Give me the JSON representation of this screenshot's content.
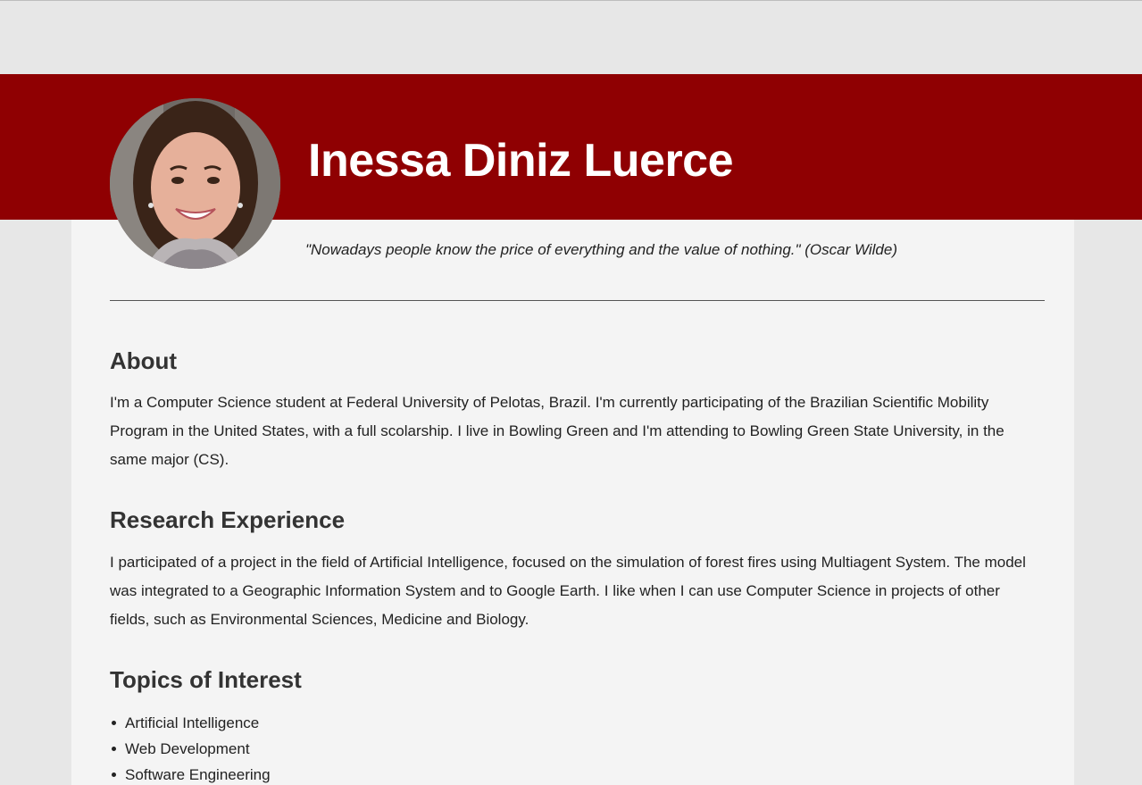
{
  "header": {
    "name": "Inessa Diniz Luerce",
    "quote": "\"Nowadays people know the price of everything and the value of nothing.\" (Oscar Wilde)",
    "colors": {
      "band": "#8f0002",
      "name_text": "#ffffff"
    },
    "avatar_icon": "profile-photo"
  },
  "sections": [
    {
      "title": "About",
      "text": "I'm a Computer Science student at Federal University of Pelotas, Brazil. I'm currently participating of the Brazilian Scientific Mobility Program in the United States, with a full scolarship. I live in Bowling Green and I'm attending to Bowling Green State University, in the same major (CS)."
    },
    {
      "title": "Research Experience",
      "text": "I participated of a project in the field of Artificial Intelligence, focused on the simulation of forest fires using Multiagent System. The model was integrated to a Geographic Information System and to Google Earth. I like when I can use Computer Science in projects of other fields, such as Environmental Sciences, Medicine and Biology."
    },
    {
      "title": "Topics of Interest",
      "items": [
        "Artificial Intelligence",
        "Web Development",
        "Software Engineering"
      ]
    }
  ],
  "colors": {
    "page_background": "#e7e7e7",
    "panel_background": "#f4f4f4",
    "heading_text": "#333333",
    "body_text": "#222222"
  }
}
